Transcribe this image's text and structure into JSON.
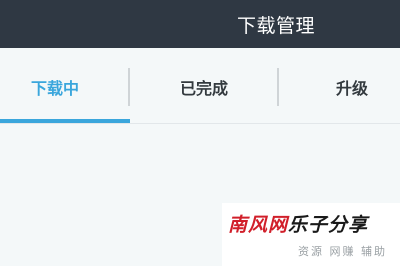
{
  "header": {
    "title": "下载管理"
  },
  "tabs": [
    {
      "label": "下载中",
      "active": true
    },
    {
      "label": "已完成",
      "active": false
    },
    {
      "label": "升级",
      "active": false
    }
  ],
  "colors": {
    "header_bg": "#2f3843",
    "accent": "#3aa6dc",
    "page_bg": "#f4f8f9"
  },
  "watermark": {
    "logo_text": "南风网",
    "logo_text_2": "乐子分享",
    "subtitle": "资源 网赚 辅助"
  }
}
